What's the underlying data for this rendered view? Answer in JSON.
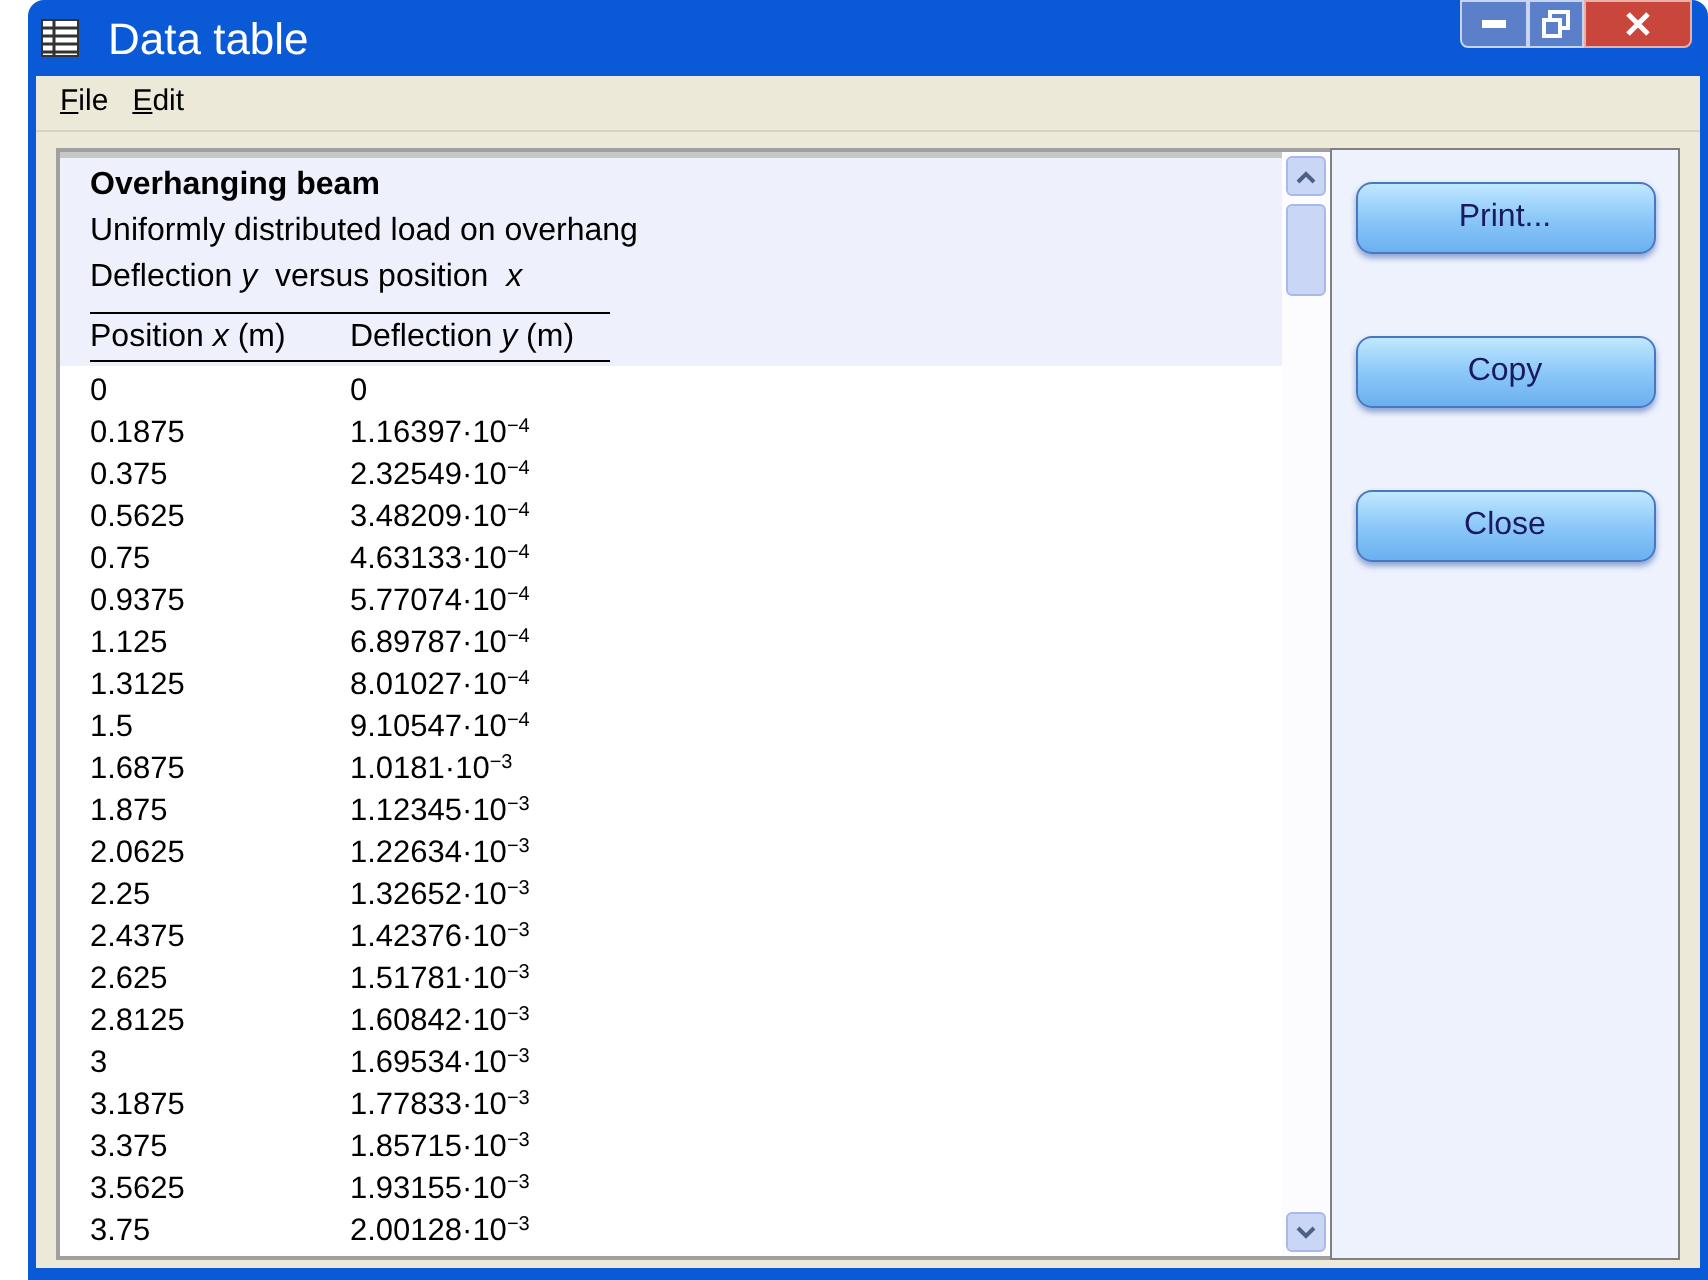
{
  "window": {
    "title": "Data table"
  },
  "menu": [
    "File",
    "Edit"
  ],
  "table": {
    "title": "Overhanging beam",
    "subtitle": "Uniformly distributed load on overhang",
    "description": "Deflection *y*  versus position  *x*",
    "columns": [
      "Position *x* (m)",
      "Deflection *y* (m)"
    ],
    "rows": [
      [
        "0",
        "0"
      ],
      [
        "0.1875",
        "1.16397·10$^{−4}$"
      ],
      [
        "0.375",
        "2.32549·10$^{−4}$"
      ],
      [
        "0.5625",
        "3.48209·10$^{−4}$"
      ],
      [
        "0.75",
        "4.63133·10$^{−4}$"
      ],
      [
        "0.9375",
        "5.77074·10$^{−4}$"
      ],
      [
        "1.125",
        "6.89787·10$^{−4}$"
      ],
      [
        "1.3125",
        "8.01027·10$^{−4}$"
      ],
      [
        "1.5",
        "9.10547·10$^{−4}$"
      ],
      [
        "1.6875",
        "1.0181·10$^{−3}$"
      ],
      [
        "1.875",
        "1.12345·10$^{−3}$"
      ],
      [
        "2.0625",
        "1.22634·10$^{−3}$"
      ],
      [
        "2.25",
        "1.32652·10$^{−3}$"
      ],
      [
        "2.4375",
        "1.42376·10$^{−3}$"
      ],
      [
        "2.625",
        "1.51781·10$^{−3}$"
      ],
      [
        "2.8125",
        "1.60842·10$^{−3}$"
      ],
      [
        "3",
        "1.69534·10$^{−3}$"
      ],
      [
        "3.1875",
        "1.77833·10$^{−3}$"
      ],
      [
        "3.375",
        "1.85715·10$^{−3}$"
      ],
      [
        "3.5625",
        "1.93155·10$^{−3}$"
      ],
      [
        "3.75",
        "2.00128·10$^{−3}$"
      ]
    ]
  },
  "buttons": [
    "Print...",
    "Copy",
    "Close"
  ]
}
